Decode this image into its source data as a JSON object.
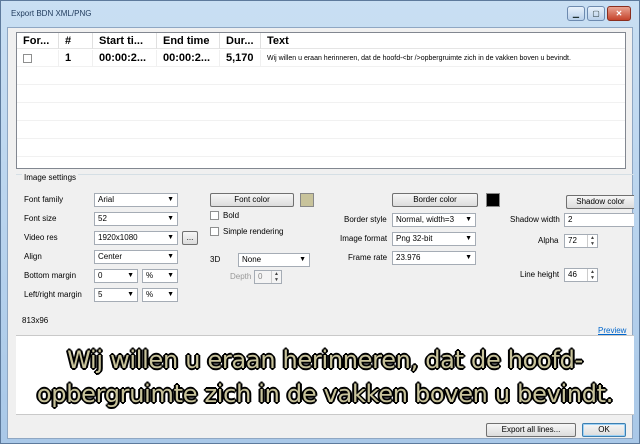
{
  "window": {
    "title": "Export BDN XML/PNG",
    "minimize_glyph": "▁",
    "maximize_glyph": "▢",
    "close_glyph": "✕"
  },
  "grid": {
    "columns": [
      "For...",
      "#",
      "Start ti...",
      "End time",
      "Dur...",
      "Text"
    ],
    "rows": [
      {
        "forced": false,
        "number": "1",
        "start": "00:00:2...",
        "end": "00:00:2...",
        "duration": "5,170",
        "text": "Wij willen u eraan herinneren, dat de hoofd-<br />opbergruimte zich in de vakken boven u bevindt."
      }
    ]
  },
  "settings": {
    "group_label": "Image settings",
    "font_family_label": "Font family",
    "font_family_value": "Arial",
    "font_size_label": "Font size",
    "font_size_value": "52",
    "video_res_label": "Video res",
    "video_res_value": "1920x1080",
    "video_res_browse": "...",
    "align_label": "Align",
    "align_value": "Center",
    "bottom_margin_label": "Bottom margin",
    "bottom_margin_value": "0",
    "bottom_margin_unit": "%",
    "lr_margin_label": "Left/right margin",
    "lr_margin_value": "5",
    "lr_margin_unit": "%",
    "font_color_button": "Font color",
    "font_color": "#c8c39b",
    "bold_label": "Bold",
    "simple_rendering_label": "Simple rendering",
    "three_d_label": "3D",
    "three_d_value": "None",
    "depth_label": "Depth",
    "depth_value": "0",
    "border_color_button": "Border color",
    "border_color": "#000000",
    "border_style_label": "Border style",
    "border_style_value": "Normal, width=3",
    "image_format_label": "Image format",
    "image_format_value": "Png 32-bit",
    "frame_rate_label": "Frame rate",
    "frame_rate_value": "23.976",
    "shadow_color_button": "Shadow color",
    "shadow_width_label": "Shadow width",
    "shadow_width_value": "2",
    "alpha_label": "Alpha",
    "alpha_value": "72",
    "line_height_label": "Line height",
    "line_height_value": "46"
  },
  "image_size": "813x96",
  "preview_link": "Preview",
  "preview_lines": [
    "Wij willen u eraan herinneren, dat de hoofd-",
    "opbergruimte zich in de vakken boven u bevindt."
  ],
  "footer": {
    "export_all_button": "Export all lines...",
    "ok_button": "OK"
  }
}
